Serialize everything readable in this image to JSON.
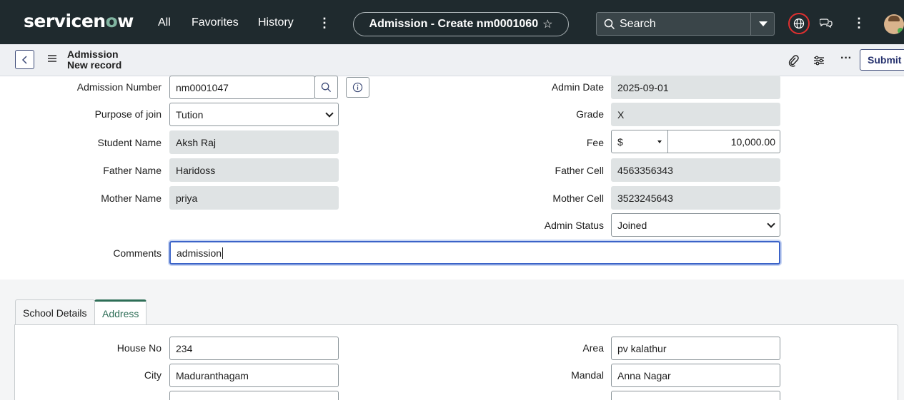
{
  "topnav": {
    "logo_pre": "servicen",
    "logo_o": "o",
    "logo_post": "w",
    "links": [
      "All",
      "Favorites",
      "History"
    ],
    "context_title": "Admission - Create nm0001060",
    "search_placeholder": "Search"
  },
  "subheader": {
    "table_name": "Admission",
    "record_state": "New record",
    "submit_label": "Submit"
  },
  "form": {
    "admission_number": {
      "label": "Admission Number",
      "value": "nm0001047"
    },
    "purpose_of_join": {
      "label": "Purpose of join",
      "value": "Tution"
    },
    "student_name": {
      "label": "Student Name",
      "value": "Aksh Raj"
    },
    "father_name": {
      "label": "Father Name",
      "value": "Haridoss"
    },
    "mother_name": {
      "label": "Mother Name",
      "value": "priya"
    },
    "admin_date": {
      "label": "Admin Date",
      "value": "2025-09-01"
    },
    "grade": {
      "label": "Grade",
      "value": "X"
    },
    "fee": {
      "label": "Fee",
      "currency": "$",
      "amount": "10,000.00"
    },
    "father_cell": {
      "label": "Father Cell",
      "value": "4563356343"
    },
    "mother_cell": {
      "label": "Mother Cell",
      "value": "3523245643"
    },
    "admin_status": {
      "label": "Admin Status",
      "value": "Joined"
    },
    "comments": {
      "label": "Comments",
      "value": "admission"
    }
  },
  "tabs": [
    {
      "label": "School Details",
      "active": false
    },
    {
      "label": "Address",
      "active": true
    }
  ],
  "address": {
    "house_no": {
      "label": "House No",
      "value": "234"
    },
    "city": {
      "label": "City",
      "value": "Maduranthagam"
    },
    "area": {
      "label": "Area",
      "value": "pv kalathur"
    },
    "mandal": {
      "label": "Mandal",
      "value": "Anna Nagar"
    }
  },
  "colors": {
    "nav_bg": "#1f2a2e",
    "logo_accent": "#81b5a1",
    "readonly_bg": "#dfe3e4",
    "focus_border": "#3b63c8",
    "active_tab": "#2e6e57",
    "globe_ring": "#e03030"
  }
}
